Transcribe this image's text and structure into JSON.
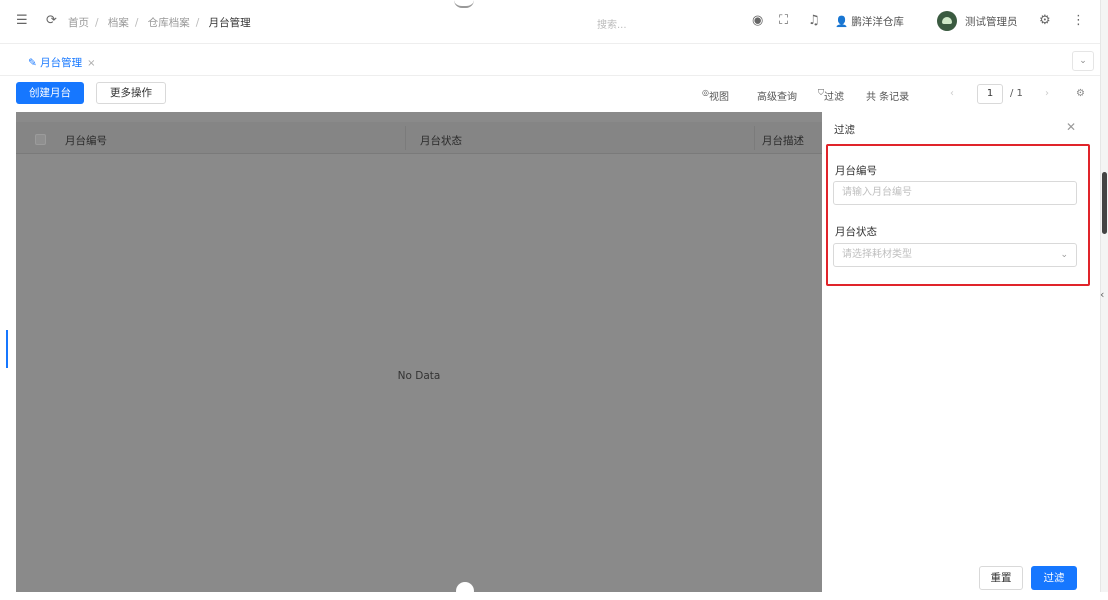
{
  "header": {
    "breadcrumb": [
      "首页",
      "档案",
      "仓库档案",
      "月台管理"
    ],
    "search_placeholder": "搜索...",
    "warehouse": "鹏洋洋仓库",
    "user": "测试管理员"
  },
  "tabs": [
    {
      "label": "月台管理",
      "close": "×"
    }
  ],
  "toolbar": {
    "create_label": "创建月台",
    "more_label": "更多操作",
    "view_label": "视图",
    "advanced_query_label": "高级查询",
    "filter_label": "过滤",
    "record_count_text": "共 条记录",
    "page_current": "1",
    "page_total": "/ 1"
  },
  "table": {
    "columns": [
      "月台编号",
      "月台状态",
      "月台描述"
    ],
    "empty_text": "No Data"
  },
  "filter_panel": {
    "title": "过滤",
    "fields": [
      {
        "label": "月台编号",
        "placeholder": "请输入月台编号"
      },
      {
        "label": "月台状态",
        "placeholder": "请选择耗材类型"
      }
    ],
    "reset_label": "重置",
    "submit_label": "过滤"
  },
  "colors": {
    "primary": "#1677ff",
    "highlight": "#e0242a",
    "mask": "#8a8a8a"
  },
  "icons": [
    "menu-icon",
    "refresh-icon",
    "target-icon",
    "fullscreen-icon",
    "bell-icon",
    "user-icon",
    "avatar",
    "settings-icon",
    "more-icon",
    "eye-icon",
    "filter-icon",
    "gear-icon",
    "close-icon",
    "chevron-down-icon"
  ]
}
